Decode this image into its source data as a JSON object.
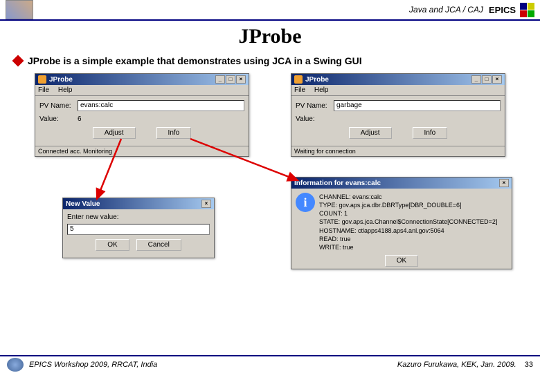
{
  "header": {
    "breadcrumb": "Java and JCA / CAJ",
    "epics": "EPICS"
  },
  "title": "JProbe",
  "bullet": "JProbe is a simple example that demonstrates using JCA in a Swing GUI",
  "win1": {
    "title": "JProbe",
    "menu": {
      "file": "File",
      "help": "Help"
    },
    "pvname_label": "PV Name:",
    "pvname_value": "evans:calc",
    "value_label": "Value:",
    "value": "6",
    "btn_adjust": "Adjust",
    "btn_info": "Info",
    "status": "Connected acc. Monitoring"
  },
  "win2": {
    "title": "JProbe",
    "menu": {
      "file": "File",
      "help": "Help"
    },
    "pvname_label": "PV Name:",
    "pvname_value": "garbage",
    "value_label": "Value:",
    "value": "",
    "btn_adjust": "Adjust",
    "btn_info": "Info",
    "status": "Waiting for connection"
  },
  "dlg_new": {
    "title": "New Value",
    "prompt": "Enter new value:",
    "input": "5",
    "ok": "OK",
    "cancel": "Cancel"
  },
  "dlg_info": {
    "title": "Information for evans:calc",
    "lines": [
      "CHANNEL: evans:calc",
      "TYPE: gov.aps.jca.dbr.DBRType[DBR_DOUBLE=6]",
      "COUNT: 1",
      "STATE: gov.aps.jca.Channel$ConnectionState[CONNECTED=2]",
      "HOSTNAME: ctlapps4188.aps4.anl.gov:5064",
      "READ: true",
      "WRITE: true"
    ],
    "ok": "OK"
  },
  "footer": {
    "left": "EPICS Workshop 2009, RRCAT, India",
    "right": "Kazuro Furukawa, KEK, Jan. 2009.",
    "page": "33"
  }
}
